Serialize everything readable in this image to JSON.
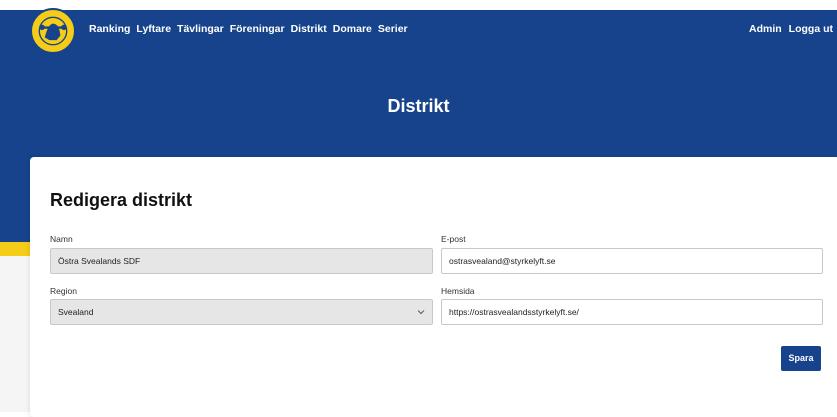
{
  "nav": {
    "items": [
      {
        "label": "Ranking"
      },
      {
        "label": "Lyftare"
      },
      {
        "label": "Tävlingar"
      },
      {
        "label": "Föreningar"
      },
      {
        "label": "Distrikt"
      },
      {
        "label": "Domare"
      },
      {
        "label": "Serier"
      }
    ],
    "right": [
      {
        "label": "Admin"
      },
      {
        "label": "Logga ut"
      }
    ]
  },
  "hero": {
    "title": "Distrikt"
  },
  "form": {
    "title": "Redigera distrikt",
    "name": {
      "label": "Namn",
      "value": "Östra Svealands SDF"
    },
    "email": {
      "label": "E-post",
      "value": "ostrasvealand@styrkelyft.se"
    },
    "region": {
      "label": "Region",
      "value": "Svealand"
    },
    "website": {
      "label": "Hemsida",
      "value": "https://ostrasvealandsstyrkelyft.se/"
    },
    "save_label": "Spara"
  },
  "colors": {
    "brand_blue": "#16438b",
    "brand_yellow": "#f5cc17",
    "field_readonly": "#e6e6e6"
  },
  "icons": {
    "logo": "club-logo",
    "select": "chevron-down-icon"
  }
}
